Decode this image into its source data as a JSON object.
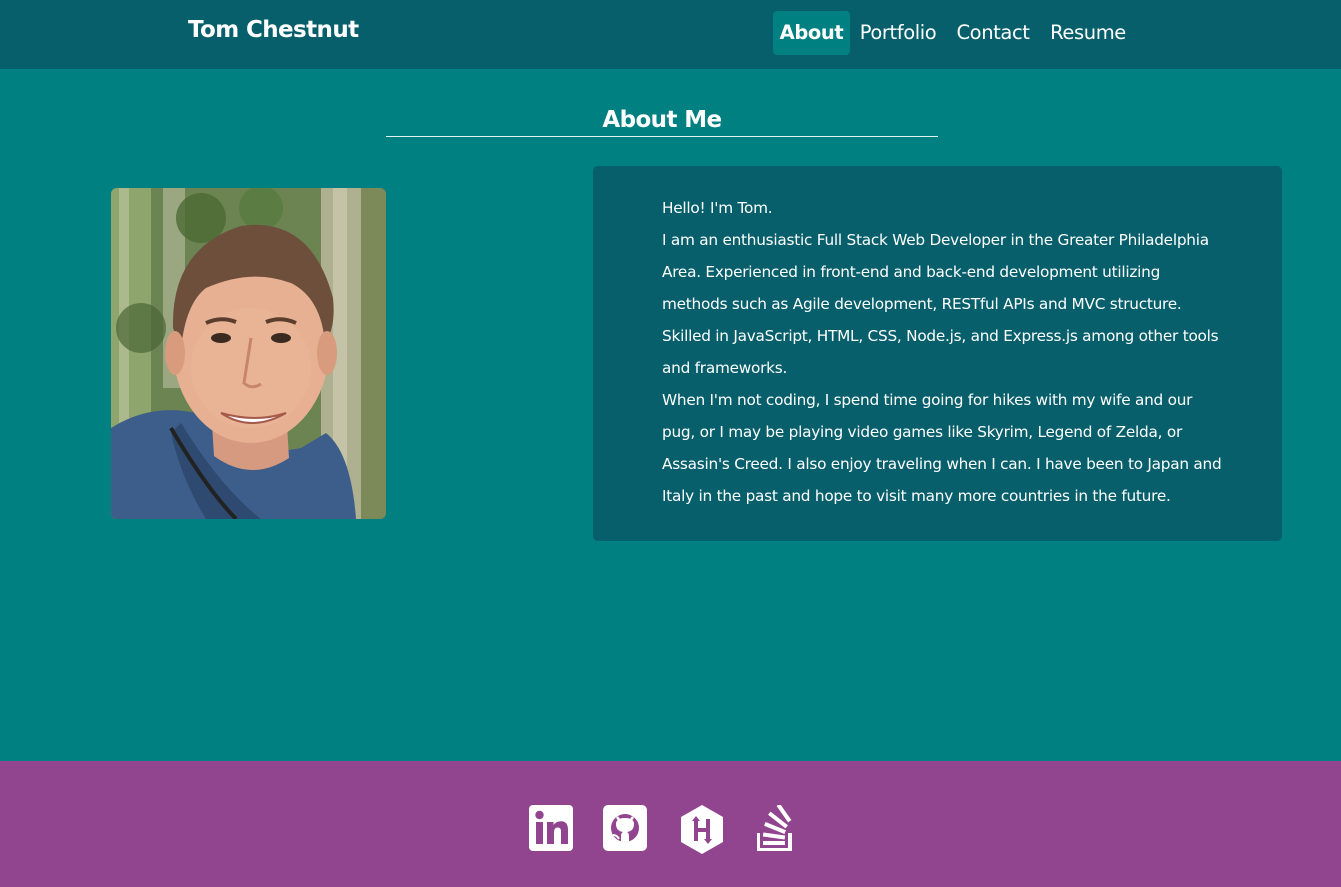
{
  "navbar": {
    "brand": "Tom Chestnut",
    "links": [
      {
        "label": "About",
        "active": true
      },
      {
        "label": "Portfolio",
        "active": false
      },
      {
        "label": "Contact",
        "active": false
      },
      {
        "label": "Resume",
        "active": false
      }
    ]
  },
  "about": {
    "title": "About Me",
    "photo_icon": "profile-photo",
    "paragraphs": [
      "Hello! I'm Tom.",
      "I am an enthusiastic Full Stack Web Developer in the Greater Philadelphia Area. Experienced in front-end and back-end development utilizing methods such as Agile development, RESTful APIs and MVC structure. Skilled in JavaScript, HTML, CSS, Node.js, and Express.js among other tools and frameworks.",
      "When I'm not coding, I spend time going for hikes with my wife and our pug, or I may be playing video games like Skyrim, Legend of Zelda, or Assasin's Creed. I also enjoy traveling when I can. I have been to Japan and Italy in the past and hope to visit many more countries in the future."
    ]
  },
  "footer": {
    "icons": [
      "linkedin-icon",
      "github-icon",
      "hackerrank-icon",
      "stackoverflow-icon"
    ]
  },
  "colors": {
    "navbar_bg": "#065f6b",
    "page_bg": "#008080",
    "card_bg": "#065f6b",
    "footer_bg": "#92458f",
    "text": "#ffffff"
  }
}
